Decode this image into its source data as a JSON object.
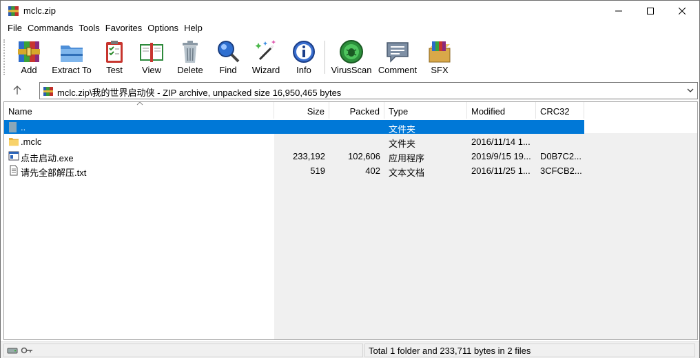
{
  "window": {
    "title": "mclc.zip"
  },
  "menu": [
    "File",
    "Commands",
    "Tools",
    "Favorites",
    "Options",
    "Help"
  ],
  "toolbar": {
    "add": "Add",
    "extract": "Extract To",
    "test": "Test",
    "view": "View",
    "delete": "Delete",
    "find": "Find",
    "wizard": "Wizard",
    "info": "Info",
    "virusscan": "VirusScan",
    "comment": "Comment",
    "sfx": "SFX"
  },
  "address": {
    "path": "mclc.zip\\我的世界启动侠 - ZIP archive, unpacked size 16,950,465 bytes"
  },
  "columns": {
    "name": "Name",
    "size": "Size",
    "packed": "Packed",
    "type": "Type",
    "modified": "Modified",
    "crc": "CRC32"
  },
  "rows": [
    {
      "name": "..",
      "size": "",
      "packed": "",
      "type": "文件夹",
      "modified": "",
      "crc": "",
      "icon": "folder-up-icon",
      "selected": true
    },
    {
      "name": ".mclc",
      "size": "",
      "packed": "",
      "type": "文件夹",
      "modified": "2016/11/14 1...",
      "crc": "",
      "icon": "folder-icon",
      "selected": false
    },
    {
      "name": "点击启动.exe",
      "size": "233,192",
      "packed": "102,606",
      "type": "应用程序",
      "modified": "2019/9/15 19...",
      "crc": "D0B7C2...",
      "icon": "exe-icon",
      "selected": false
    },
    {
      "name": "请先全部解压.txt",
      "size": "519",
      "packed": "402",
      "type": "文本文档",
      "modified": "2016/11/25 1...",
      "crc": "3CFCB2...",
      "icon": "text-file-icon",
      "selected": false
    }
  ],
  "status": {
    "summary": "Total 1 folder and 233,711 bytes in 2 files"
  },
  "colors": {
    "selection": "#0078d7",
    "folder": "#f5c342"
  }
}
